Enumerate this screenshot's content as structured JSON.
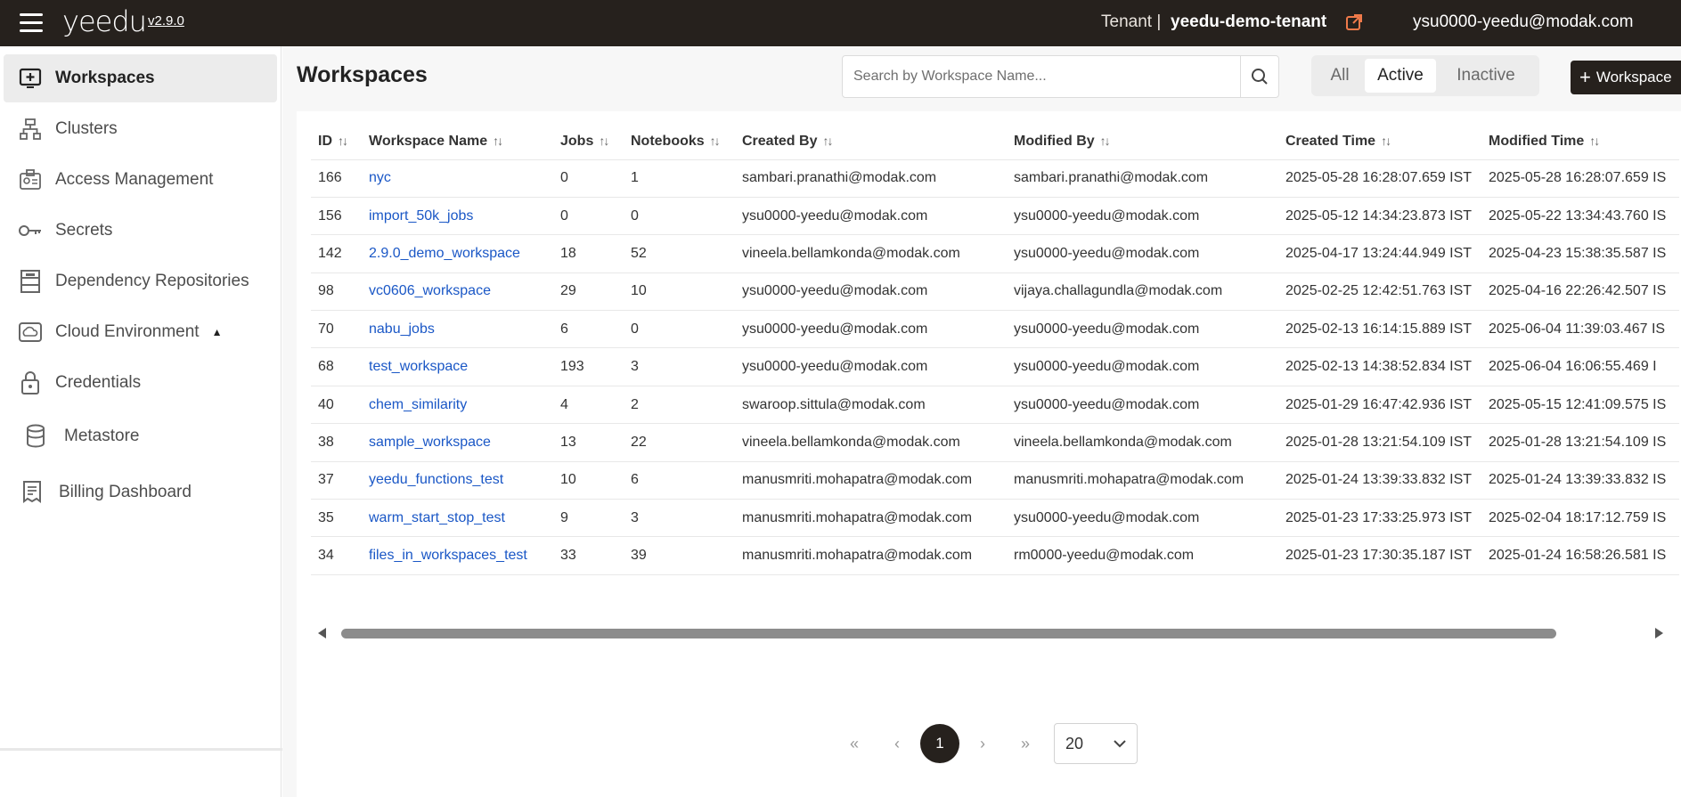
{
  "header": {
    "logo": "yeedu",
    "version": "v2.9.0",
    "tenant_label": "Tenant |",
    "tenant_name": "yeedu-demo-tenant",
    "user_email": "ysu0000-yeedu@modak.com"
  },
  "sidebar": {
    "items": [
      {
        "label": "Workspaces",
        "icon": "add-box-icon",
        "active": true
      },
      {
        "label": "Clusters",
        "icon": "cluster-icon"
      },
      {
        "label": "Access Management",
        "icon": "id-badge-icon"
      },
      {
        "label": "Secrets",
        "icon": "key-icon"
      },
      {
        "label": "Dependency Repositories",
        "icon": "repository-icon"
      },
      {
        "label": "Cloud Environment",
        "icon": "cloud-icon",
        "expanded": true
      },
      {
        "label": "Credentials",
        "icon": "lock-icon"
      },
      {
        "label": "Metastore",
        "icon": "database-icon"
      },
      {
        "label": "Billing Dashboard",
        "icon": "receipt-icon"
      }
    ]
  },
  "main": {
    "title": "Workspaces",
    "search": {
      "placeholder": "Search by Workspace Name...",
      "value": ""
    },
    "filters": [
      {
        "label": "All"
      },
      {
        "label": "Active",
        "active": true
      },
      {
        "label": "Inactive"
      }
    ],
    "add_button": "Workspace",
    "table": {
      "columns": [
        "ID",
        "Workspace Name",
        "Jobs",
        "Notebooks",
        "Created By",
        "Modified By",
        "Created Time",
        "Modified Time"
      ],
      "rows": [
        [
          "166",
          "nyc",
          "0",
          "1",
          "sambari.pranathi@modak.com",
          "sambari.pranathi@modak.com",
          "2025-05-28 16:28:07.659 IST",
          "2025-05-28 16:28:07.659 IS"
        ],
        [
          "156",
          "import_50k_jobs",
          "0",
          "0",
          "ysu0000-yeedu@modak.com",
          "ysu0000-yeedu@modak.com",
          "2025-05-12 14:34:23.873 IST",
          "2025-05-22 13:34:43.760 IS"
        ],
        [
          "142",
          "2.9.0_demo_workspace",
          "18",
          "52",
          "vineela.bellamkonda@modak.com",
          "ysu0000-yeedu@modak.com",
          "2025-04-17 13:24:44.949 IST",
          "2025-04-23 15:38:35.587 IS"
        ],
        [
          "98",
          "vc0606_workspace",
          "29",
          "10",
          "ysu0000-yeedu@modak.com",
          "vijaya.challagundla@modak.com",
          "2025-02-25 12:42:51.763 IST",
          "2025-04-16 22:26:42.507 IS"
        ],
        [
          "70",
          "nabu_jobs",
          "6",
          "0",
          "ysu0000-yeedu@modak.com",
          "ysu0000-yeedu@modak.com",
          "2025-02-13 16:14:15.889 IST",
          "2025-06-04 11:39:03.467 IS"
        ],
        [
          "68",
          "test_workspace",
          "193",
          "3",
          "ysu0000-yeedu@modak.com",
          "ysu0000-yeedu@modak.com",
          "2025-02-13 14:38:52.834 IST",
          "2025-06-04 16:06:55.469 I"
        ],
        [
          "40",
          "chem_similarity",
          "4",
          "2",
          "swaroop.sittula@modak.com",
          "ysu0000-yeedu@modak.com",
          "2025-01-29 16:47:42.936 IST",
          "2025-05-15 12:41:09.575 IS"
        ],
        [
          "38",
          "sample_workspace",
          "13",
          "22",
          "vineela.bellamkonda@modak.com",
          "vineela.bellamkonda@modak.com",
          "2025-01-28 13:21:54.109 IST",
          "2025-01-28 13:21:54.109 IS"
        ],
        [
          "37",
          "yeedu_functions_test",
          "10",
          "6",
          "manusmriti.mohapatra@modak.com",
          "manusmriti.mohapatra@modak.com",
          "2025-01-24 13:39:33.832 IST",
          "2025-01-24 13:39:33.832 IS"
        ],
        [
          "35",
          "warm_start_stop_test",
          "9",
          "3",
          "manusmriti.mohapatra@modak.com",
          "ysu0000-yeedu@modak.com",
          "2025-01-23 17:33:25.973 IST",
          "2025-02-04 18:17:12.759 IS"
        ],
        [
          "34",
          "files_in_workspaces_test",
          "33",
          "39",
          "manusmriti.mohapatra@modak.com",
          "rm0000-yeedu@modak.com",
          "2025-01-23 17:30:35.187 IST",
          "2025-01-24 16:58:26.581 IS"
        ]
      ]
    },
    "pagination": {
      "first": "«",
      "prev": "‹",
      "current": "1",
      "next": "›",
      "last": "»",
      "page_size": "20"
    }
  },
  "colors": {
    "dark": "#26211d",
    "link": "#1a57c6",
    "external_icon": "#f07a4a"
  }
}
